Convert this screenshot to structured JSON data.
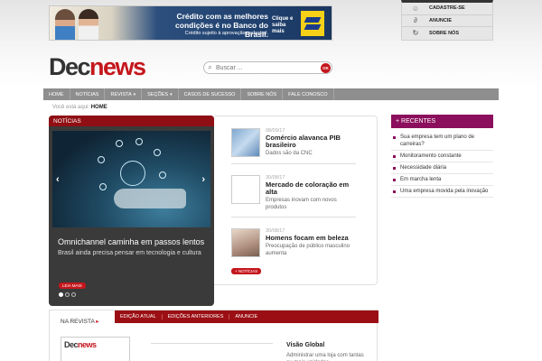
{
  "banner": {
    "headline": "Crédito com as melhores condições é no Banco do Brasil.",
    "subtext": "Crédito sujeito à aprovação cadastral.",
    "cta": "Clique e saiba mais"
  },
  "quick_links": [
    {
      "label": "CADASTRE-SE",
      "icon": "user-icon"
    },
    {
      "label": "ANUNCIE",
      "icon": "paperclip-icon"
    },
    {
      "label": "SOBRE NÓS",
      "icon": "refresh-icon"
    }
  ],
  "logo": {
    "part1": "Dec",
    "part2": "news"
  },
  "search": {
    "placeholder": "Buscar ...",
    "button": "OK"
  },
  "nav": [
    "HOME",
    "NOTÍCIAS",
    "REVISTA",
    "SEÇÕES",
    "CASOS DE SUCESSO",
    "SOBRE NÓS",
    "FALE CONOSCO"
  ],
  "breadcrumb": {
    "prefix": "Você está aqui:",
    "current": "HOME"
  },
  "featured": {
    "section": "NOTÍCIAS",
    "title": "Omnichannel caminha em passos lentos",
    "subtitle": "Brasil ainda precisa pensar em tecnologia e cultura",
    "read_more": "LEIA MAIS"
  },
  "news": [
    {
      "date": "08/09/17",
      "title": "Comércio alavanca PIB brasileiro",
      "desc": "Dados são da CNC"
    },
    {
      "date": "30/08/17",
      "title": "Mercado de coloração em alta",
      "desc": "Empresas inovam com novos produtos"
    },
    {
      "date": "30/08/17",
      "title": "Homens focam em beleza",
      "desc": "Preocupação de público masculino aumenta"
    }
  ],
  "more_news": "+ NOTÍCIAS",
  "recent": {
    "title": "+ RECENTES",
    "items": [
      "Sua empresa tem um plano de carreiras?",
      "Monitoramento constante",
      "Necessidade diária",
      "Em marcha lenta",
      "Uma empresa movida pela inovação"
    ]
  },
  "magazine": {
    "label": "NA REVISTA",
    "tabs": [
      "EDIÇÃO ATUAL",
      "EDIÇÕES ANTERIORES",
      "ANUNCIE"
    ],
    "headline": "Visão Global",
    "desc": "Administrar uma loja com tantas ou mais unidades"
  }
}
